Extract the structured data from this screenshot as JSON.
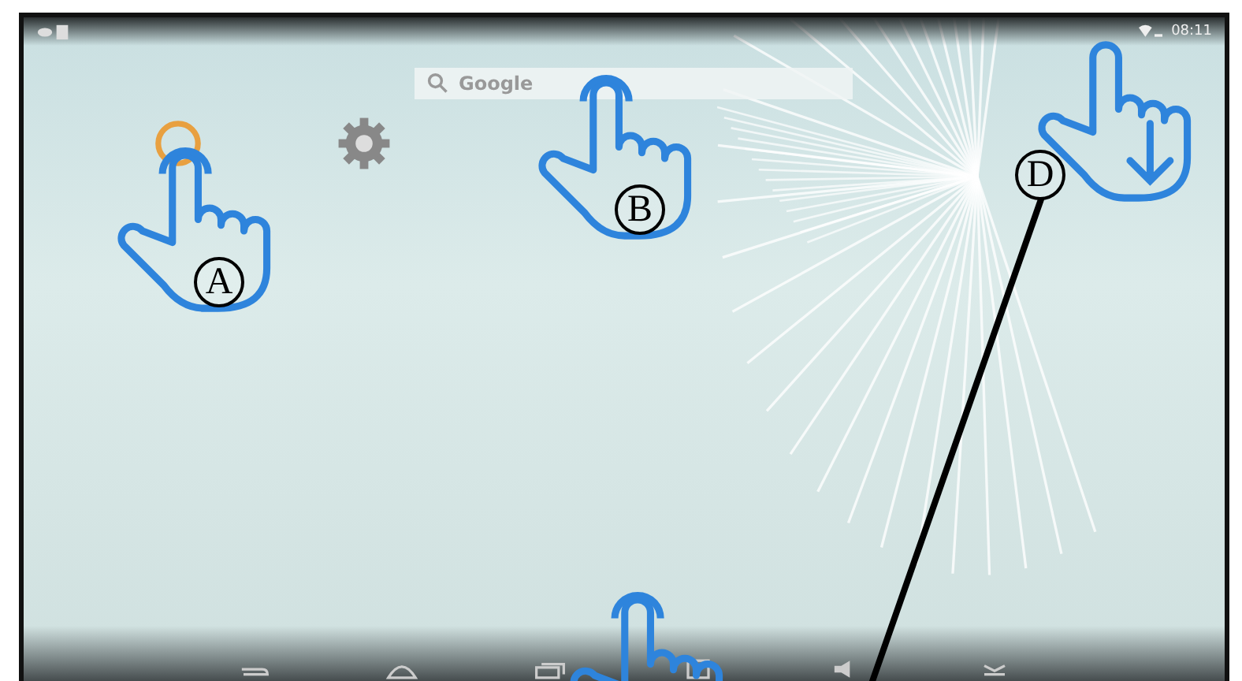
{
  "status_bar": {
    "time": "08:11"
  },
  "search": {
    "placeholder": "Google"
  },
  "gestures": [
    {
      "kind": "tap",
      "label": "A"
    },
    {
      "kind": "tap",
      "label": "B"
    },
    {
      "kind": "swipe_down"
    },
    {
      "kind": "tap"
    }
  ],
  "callouts": [
    {
      "label": "D"
    }
  ]
}
